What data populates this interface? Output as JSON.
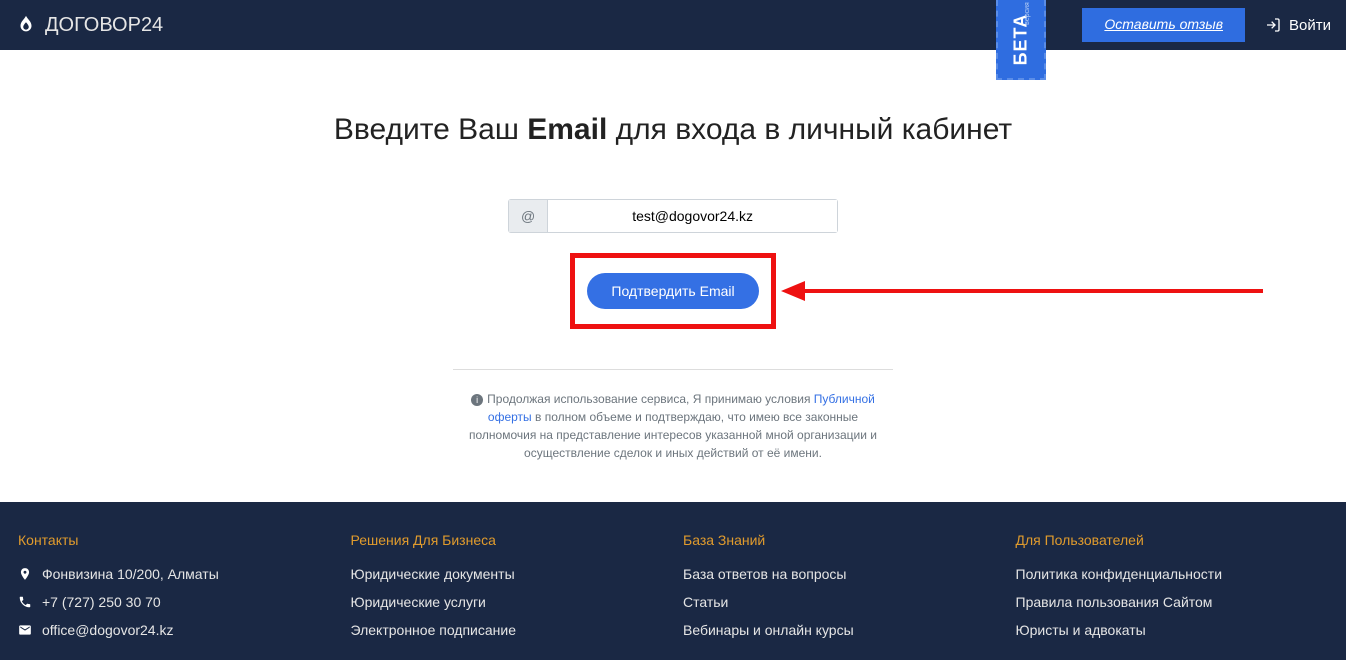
{
  "header": {
    "logo_text": "ДОГОВОР24",
    "beta": "БЕТА",
    "beta_sub": "версия",
    "feedback": "Оставить отзыв",
    "login": "Войти"
  },
  "main": {
    "title_pre": "Введите Ваш ",
    "title_bold": "Email",
    "title_post": " для входа в личный кабинет",
    "email_value": "test@dogovor24.kz",
    "at_symbol": "@",
    "confirm_label": "Подтвердить Email",
    "disclaimer_1": "Продолжая использование сервиса, Я принимаю условия ",
    "disclaimer_link": "Публичной оферты",
    "disclaimer_2": " в полном объеме и подтверждаю, что имею все законные полномочия на представление интересов указанной мной организации и осуществление сделок и иных действий от её имени."
  },
  "footer": {
    "col1": {
      "heading": "Контакты",
      "address": "Фонвизина 10/200, Алматы",
      "phone": "+7 (727) 250 30 70",
      "email": "office@dogovor24.kz"
    },
    "col2": {
      "heading": "Решения Для Бизнеса",
      "links": [
        "Юридические документы",
        "Юридические услуги",
        "Электронное подписание"
      ]
    },
    "col3": {
      "heading": "База Знаний",
      "links": [
        "База ответов на вопросы",
        "Статьи",
        "Вебинары и онлайн курсы"
      ]
    },
    "col4": {
      "heading": "Для Пользователей",
      "links": [
        "Политика конфиденциальности",
        "Правила пользования Сайтом",
        "Юристы и адвокаты"
      ]
    }
  }
}
